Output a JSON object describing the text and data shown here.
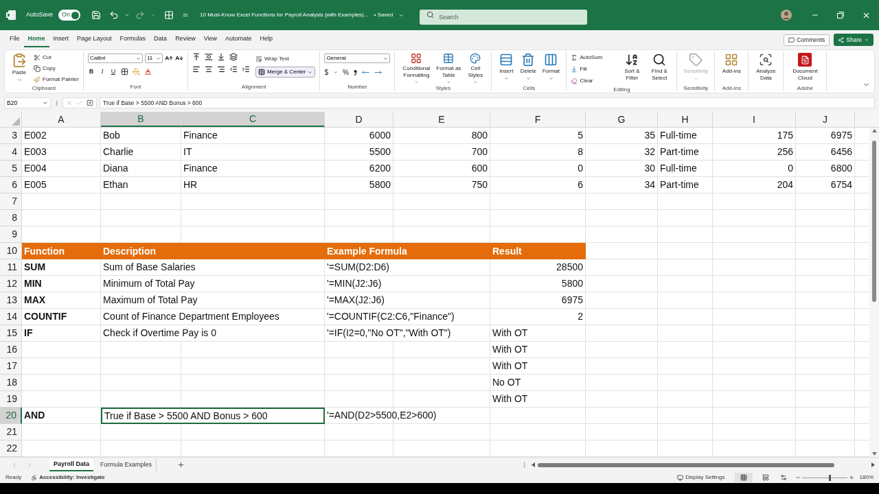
{
  "title_bar": {
    "autosave_label": "AutoSave",
    "autosave": {
      "label": "On",
      "on": true
    },
    "document_title": "10 Must-Know Excel Functions for Payroll Analysis (with Examples)...",
    "save_status": "• Saved",
    "search": {
      "placeholder": "Search"
    }
  },
  "menu_tabs": [
    {
      "label": "File",
      "selected": false
    },
    {
      "label": "Home",
      "selected": true
    },
    {
      "label": "Insert",
      "selected": false
    },
    {
      "label": "Page Layout",
      "selected": false
    },
    {
      "label": "Formulas",
      "selected": false
    },
    {
      "label": "Data",
      "selected": false
    },
    {
      "label": "Review",
      "selected": false
    },
    {
      "label": "View",
      "selected": false
    },
    {
      "label": "Automate",
      "selected": false
    },
    {
      "label": "Help",
      "selected": false
    }
  ],
  "header_buttons": {
    "comments": "Comments",
    "share": "Share"
  },
  "ribbon": [
    {
      "kind": "clipboard",
      "label": "Clipboard",
      "items": [
        "Paste",
        "Cut",
        "Copy",
        "Format Painter"
      ]
    },
    {
      "kind": "font",
      "label": "Font",
      "font": "Calibri",
      "size": "11",
      "items": [
        "B",
        "I",
        "U"
      ]
    },
    {
      "kind": "alignment",
      "label": "Alignment",
      "items": [
        "Wrap Text",
        "Merge & Center"
      ]
    },
    {
      "kind": "number",
      "label": "Number",
      "format": "General",
      "items": [
        "$",
        "%"
      ]
    },
    {
      "kind": "styles",
      "label": "Styles",
      "items": [
        "Conditional Formatting",
        "Format as Table",
        "Cell Styles"
      ]
    },
    {
      "kind": "cells",
      "label": "Cells",
      "items": [
        "Insert",
        "Delete",
        "Format"
      ]
    },
    {
      "kind": "editing",
      "label": "Editing",
      "items": [
        "AutoSum",
        "Fill",
        "Clear",
        "Sort & Filter",
        "Find & Select"
      ]
    },
    {
      "kind": "sensitivity",
      "label": "Sensitivity",
      "items": [
        "Sensitivity"
      ],
      "disabled": true
    },
    {
      "kind": "addins",
      "label": "Add-ins",
      "items": [
        "Add-ins"
      ]
    },
    {
      "kind": "analyze",
      "items": [
        "Analyze Data"
      ]
    },
    {
      "kind": "adobe",
      "label": "Adobe",
      "items": [
        "Document Cloud"
      ]
    }
  ],
  "formula_bar": {
    "name_box": "B20",
    "formula": "True if Base > 5500 AND Bonus > 600"
  },
  "columns": [
    {
      "label": "A",
      "selected": false
    },
    {
      "label": "B",
      "selected": true
    },
    {
      "label": "C",
      "selected": true
    },
    {
      "label": "D",
      "selected": false
    },
    {
      "label": "E",
      "selected": false
    },
    {
      "label": "F",
      "selected": false
    },
    {
      "label": "G",
      "selected": false
    },
    {
      "label": "H",
      "selected": false
    },
    {
      "label": "I",
      "selected": false
    },
    {
      "label": "J",
      "selected": false
    }
  ],
  "rows": [
    {
      "number": "3",
      "kind": "data",
      "selected": false,
      "cells": [
        {
          "text": "E002",
          "kind": "text",
          "selected": false
        },
        {
          "text": "Bob",
          "kind": "text",
          "selected": false
        },
        {
          "text": "Finance",
          "kind": "text",
          "selected": false
        },
        {
          "text": "6000",
          "kind": "number",
          "selected": false
        },
        {
          "text": "800",
          "kind": "number",
          "selected": false
        },
        {
          "text": "5",
          "kind": "number",
          "selected": false
        },
        {
          "text": "35",
          "kind": "number",
          "selected": false
        },
        {
          "text": "Full-time",
          "kind": "text",
          "selected": false
        },
        {
          "text": "175",
          "kind": "number",
          "selected": false
        },
        {
          "text": "6975",
          "kind": "number",
          "selected": false
        }
      ]
    },
    {
      "number": "4",
      "kind": "data",
      "selected": false,
      "cells": [
        {
          "text": "E003",
          "kind": "text",
          "selected": false
        },
        {
          "text": "Charlie",
          "kind": "text",
          "selected": false
        },
        {
          "text": "IT",
          "kind": "text",
          "selected": false
        },
        {
          "text": "5500",
          "kind": "number",
          "selected": false
        },
        {
          "text": "700",
          "kind": "number",
          "selected": false
        },
        {
          "text": "8",
          "kind": "number",
          "selected": false
        },
        {
          "text": "32",
          "kind": "number",
          "selected": false
        },
        {
          "text": "Part-time",
          "kind": "text",
          "selected": false
        },
        {
          "text": "256",
          "kind": "number",
          "selected": false
        },
        {
          "text": "6456",
          "kind": "number",
          "selected": false
        }
      ]
    },
    {
      "number": "5",
      "kind": "data",
      "selected": false,
      "cells": [
        {
          "text": "E004",
          "kind": "text",
          "selected": false
        },
        {
          "text": "Diana",
          "kind": "text",
          "selected": false
        },
        {
          "text": "Finance",
          "kind": "text",
          "selected": false
        },
        {
          "text": "6200",
          "kind": "number",
          "selected": false
        },
        {
          "text": "600",
          "kind": "number",
          "selected": false
        },
        {
          "text": "0",
          "kind": "number",
          "selected": false
        },
        {
          "text": "30",
          "kind": "number",
          "selected": false
        },
        {
          "text": "Full-time",
          "kind": "text",
          "selected": false
        },
        {
          "text": "0",
          "kind": "number",
          "selected": false
        },
        {
          "text": "6800",
          "kind": "number",
          "selected": false
        }
      ]
    },
    {
      "number": "6",
      "kind": "data",
      "selected": false,
      "cells": [
        {
          "text": "E005",
          "kind": "text",
          "selected": false
        },
        {
          "text": "Ethan",
          "kind": "text",
          "selected": false
        },
        {
          "text": "HR",
          "kind": "text",
          "selected": false
        },
        {
          "text": "5800",
          "kind": "number",
          "selected": false
        },
        {
          "text": "750",
          "kind": "number",
          "selected": false
        },
        {
          "text": "6",
          "kind": "number",
          "selected": false
        },
        {
          "text": "34",
          "kind": "number",
          "selected": false
        },
        {
          "text": "Part-time",
          "kind": "text",
          "selected": false
        },
        {
          "text": "204",
          "kind": "number",
          "selected": false
        },
        {
          "text": "6754",
          "kind": "number",
          "selected": false
        }
      ]
    },
    {
      "number": "7",
      "kind": "data",
      "selected": false
    },
    {
      "number": "8",
      "kind": "data",
      "selected": false
    },
    {
      "number": "9",
      "kind": "data",
      "selected": false
    },
    {
      "number": "10",
      "kind": "header",
      "selected": false,
      "cells": [
        {
          "text": "Function",
          "kind": "text",
          "selected": false
        },
        {
          "text": "Description",
          "kind": "text",
          "selected": false
        },
        null,
        {
          "text": "Example Formula",
          "kind": "text",
          "selected": false
        },
        null,
        {
          "text": "Result",
          "kind": "text",
          "selected": false
        }
      ]
    },
    {
      "number": "11",
      "kind": "data",
      "selected": false,
      "cells": [
        {
          "text": "SUM",
          "kind": "bold",
          "selected": false
        },
        {
          "text": "Sum of Base Salaries",
          "kind": "text",
          "selected": false
        },
        null,
        {
          "text": "'=SUM(D2:D6)",
          "kind": "text",
          "selected": false
        },
        null,
        {
          "text": "28500",
          "kind": "number",
          "selected": false
        }
      ]
    },
    {
      "number": "12",
      "kind": "data",
      "selected": false,
      "cells": [
        {
          "text": "MIN",
          "kind": "bold",
          "selected": false
        },
        {
          "text": "Minimum of Total Pay",
          "kind": "text",
          "selected": false
        },
        null,
        {
          "text": "'=MIN(J2:J6)",
          "kind": "text",
          "selected": false
        },
        null,
        {
          "text": "5800",
          "kind": "number",
          "selected": false
        }
      ]
    },
    {
      "number": "13",
      "kind": "data",
      "selected": false,
      "cells": [
        {
          "text": "MAX",
          "kind": "bold",
          "selected": false
        },
        {
          "text": "Maximum of Total Pay",
          "kind": "text",
          "selected": false
        },
        null,
        {
          "text": "'=MAX(J2:J6)",
          "kind": "text",
          "selected": false
        },
        null,
        {
          "text": "6975",
          "kind": "number",
          "selected": false
        }
      ]
    },
    {
      "number": "14",
      "kind": "data",
      "selected": false,
      "cells": [
        {
          "text": "COUNTIF",
          "kind": "bold",
          "selected": false
        },
        {
          "text": "Count of Finance Department Employees",
          "kind": "text",
          "selected": false
        },
        null,
        {
          "text": "'=COUNTIF(C2:C6,\"Finance\")",
          "kind": "text",
          "selected": false
        },
        null,
        {
          "text": "2",
          "kind": "number",
          "selected": false
        }
      ]
    },
    {
      "number": "15",
      "kind": "data",
      "selected": false,
      "cells": [
        {
          "text": "IF",
          "kind": "bold",
          "selected": false
        },
        {
          "text": "Check if Overtime Pay is 0",
          "kind": "text",
          "selected": false
        },
        null,
        {
          "text": "'=IF(I2=0,\"No OT\",\"With OT\")",
          "kind": "text",
          "selected": false
        },
        null,
        {
          "text": "With OT",
          "kind": "text",
          "selected": false
        }
      ]
    },
    {
      "number": "16",
      "kind": "data",
      "selected": false,
      "cells": [
        null,
        null,
        null,
        null,
        null,
        {
          "text": "With OT",
          "kind": "text",
          "selected": false
        }
      ]
    },
    {
      "number": "17",
      "kind": "data",
      "selected": false,
      "cells": [
        null,
        null,
        null,
        null,
        null,
        {
          "text": "With OT",
          "kind": "text",
          "selected": false
        }
      ]
    },
    {
      "number": "18",
      "kind": "data",
      "selected": false,
      "cells": [
        null,
        null,
        null,
        null,
        null,
        {
          "text": "No OT",
          "kind": "text",
          "selected": false
        }
      ]
    },
    {
      "number": "19",
      "kind": "data",
      "selected": false,
      "cells": [
        null,
        null,
        null,
        null,
        null,
        {
          "text": "With OT",
          "kind": "text",
          "selected": false
        }
      ]
    },
    {
      "number": "20",
      "kind": "data",
      "selected": true,
      "cells": [
        {
          "text": "AND",
          "kind": "bold",
          "selected": false
        },
        {
          "text": "True if Base > 5500 AND Bonus > 600",
          "kind": "text",
          "selected": true
        },
        null,
        {
          "text": "'=AND(D2>5500,E2>600)",
          "kind": "text",
          "selected": false
        }
      ]
    },
    {
      "number": "21",
      "kind": "data",
      "selected": false
    },
    {
      "number": "22",
      "kind": "data",
      "selected": false
    }
  ],
  "sheet_tabs": [
    {
      "label": "Payroll Data",
      "selected": true
    },
    {
      "label": "Formula Examples",
      "selected": false
    }
  ],
  "status_bar": {
    "mode": "Ready",
    "accessibility": "Accessibility: Investigate",
    "display_settings": "Display Settings",
    "zoom": {
      "level": 0.62,
      "reading": "180%"
    }
  }
}
